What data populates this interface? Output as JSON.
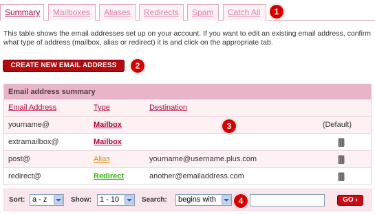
{
  "tabs": [
    {
      "label": "Summary",
      "active": true
    },
    {
      "label": "Mailboxes",
      "active": false
    },
    {
      "label": "Aliases",
      "active": false
    },
    {
      "label": "Redirects",
      "active": false
    },
    {
      "label": "Spam",
      "active": false
    },
    {
      "label": "Catch All",
      "active": false
    }
  ],
  "callouts": [
    "1",
    "2",
    "3",
    "4"
  ],
  "intro_text": "This table shows the email addresses set up on your account. If you want to edit an existing email address, confirm what type of address (mailbox, alias or redirect) it is and click on the appropriate tab.",
  "create_button": "CREATE NEW EMAIL ADDRESS",
  "summary": {
    "title": "Email address summary",
    "columns": {
      "email": "Email Address",
      "type": "Type",
      "destination": "Destination"
    },
    "rows": [
      {
        "email": "yourname@",
        "type": "Mailbox",
        "type_color": "#b3003b",
        "destination": "",
        "status": "(Default)",
        "deletable": false
      },
      {
        "email": "extramailbox@",
        "type": "Mailbox",
        "type_color": "#b3003b",
        "destination": "",
        "status": "",
        "deletable": true
      },
      {
        "email": "post@",
        "type": "Alias",
        "type_color": "#f08a00",
        "destination": "yourname@username.plus.com",
        "status": "",
        "deletable": true
      },
      {
        "email": "redirect@",
        "type": "Redirect",
        "type_color": "#2eb800",
        "destination": "another@emailaddress.com",
        "status": "",
        "deletable": true
      }
    ]
  },
  "bottom": {
    "sort_label": "Sort:",
    "sort_value": "a - z",
    "show_label": "Show:",
    "show_value": "1 - 10",
    "search_label": "Search:",
    "search_mode": "begins with",
    "search_value": "",
    "go_label": "GO"
  },
  "colors": {
    "accent": "#b3003b",
    "button_red": "#b10a10",
    "header_pink": "#e8b5c8",
    "row_tint": "#fdf1f4"
  }
}
